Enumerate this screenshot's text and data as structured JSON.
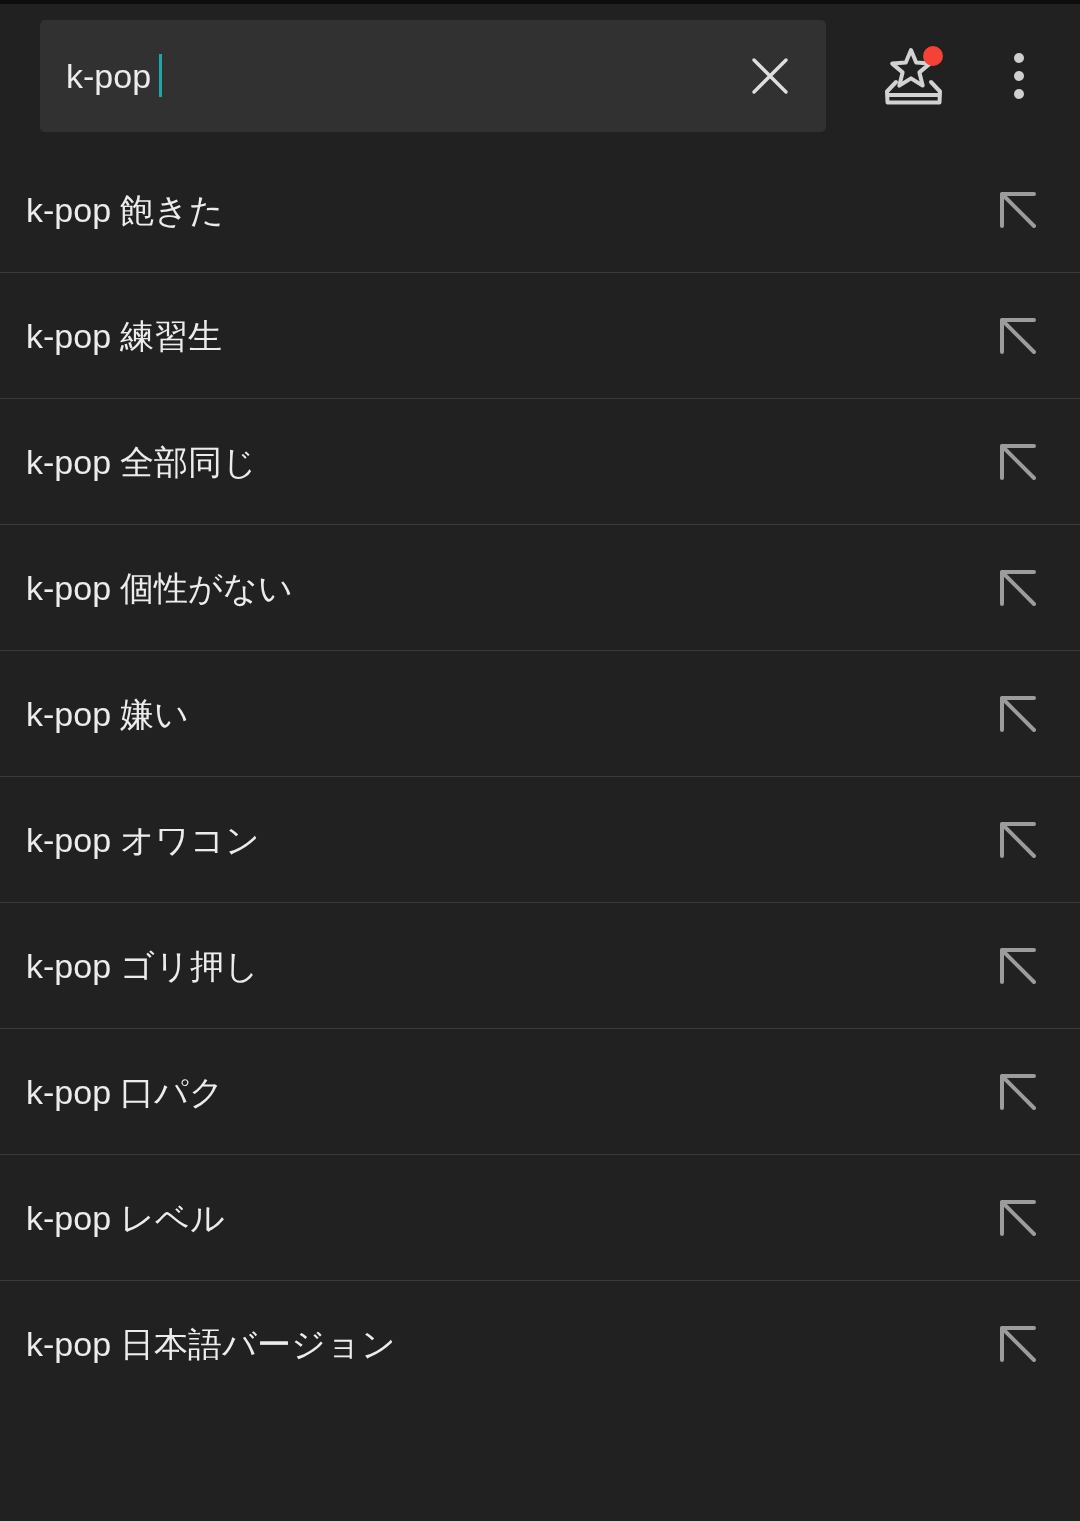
{
  "search_bar": {
    "value": "k-pop",
    "focused": true,
    "notification": true
  },
  "suggestions": [
    {
      "text": "k-pop 飽きた"
    },
    {
      "text": "k-pop 練習生"
    },
    {
      "text": "k-pop 全部同じ"
    },
    {
      "text": "k-pop 個性がない"
    },
    {
      "text": "k-pop 嫌い"
    },
    {
      "text": "k-pop オワコン"
    },
    {
      "text": "k-pop ゴリ押し"
    },
    {
      "text": "k-pop 口パク"
    },
    {
      "text": "k-pop レベル"
    },
    {
      "text": "k-pop 日本語バージョン"
    }
  ]
}
